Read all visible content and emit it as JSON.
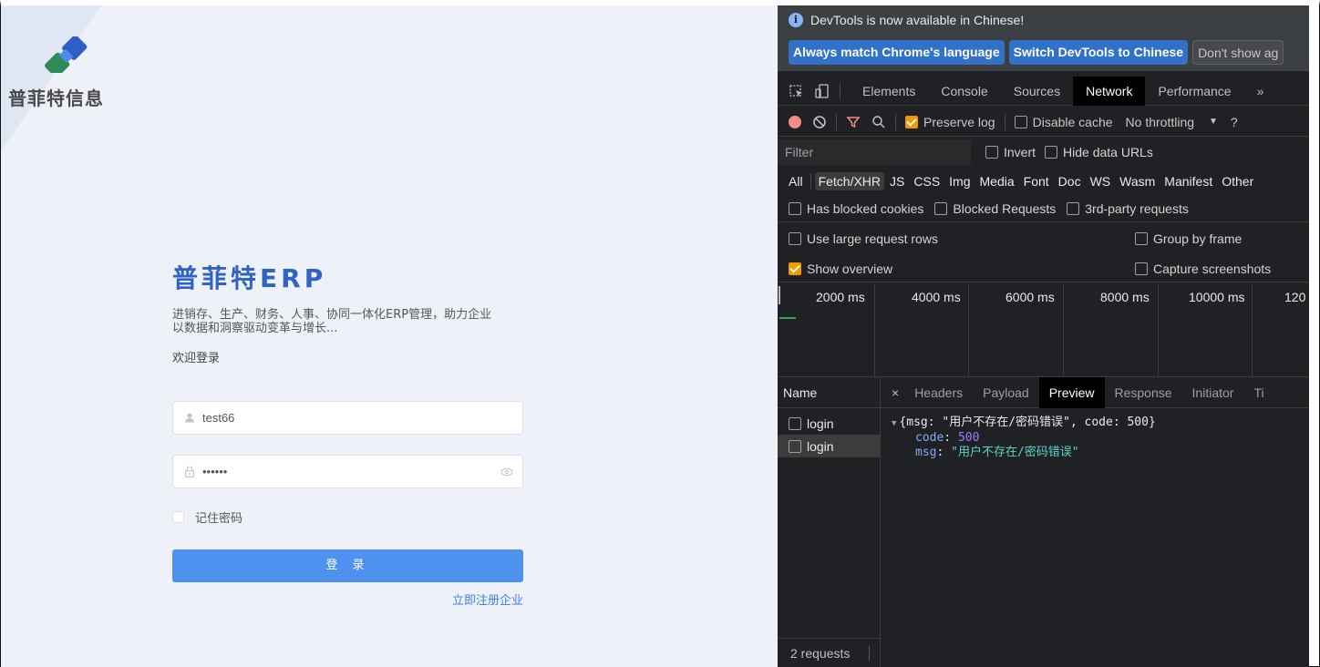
{
  "login": {
    "logo_text": "普菲特信息",
    "brand_title": "普菲特ERP",
    "brand_desc_line1": "进销存、生产、财务、人事、协同一体化ERP管理，助力企业",
    "brand_desc_line2": "以数据和洞察驱动变革与增长...",
    "welcome": "欢迎登录",
    "username_value": "test66",
    "password_value": "••••••",
    "remember_label": "记住密码",
    "login_button": "登 录",
    "register_link": "立即注册企业",
    "colors": {
      "brand": "#2f64c6",
      "button": "#4e91ee",
      "background": "#eef2f8"
    }
  },
  "devtools": {
    "info_message": "DevTools is now available in Chinese!",
    "info_buttons": [
      "Always match Chrome's language",
      "Switch DevTools to Chinese",
      "Don't show ag"
    ],
    "tabs": [
      "Elements",
      "Console",
      "Sources",
      "Network",
      "Performance",
      "»"
    ],
    "active_tab": "Network",
    "toolbar": {
      "preserve_log": "Preserve log",
      "disable_cache": "Disable cache",
      "throttling": "No throttling",
      "throttle_arrow": "▼",
      "more": "?"
    },
    "filter_placeholder": "Filter",
    "invert": "Invert",
    "hide_data_urls": "Hide data URLs",
    "types": [
      "All",
      "Fetch/XHR",
      "JS",
      "CSS",
      "Img",
      "Media",
      "Font",
      "Doc",
      "WS",
      "Wasm",
      "Manifest",
      "Other"
    ],
    "active_type": "Fetch/XHR",
    "has_blocked_cookies": "Has blocked cookies",
    "blocked_requests": "Blocked Requests",
    "third_party": "3rd-party requests",
    "use_large_rows": "Use large request rows",
    "group_by_frame": "Group by frame",
    "show_overview": "Show overview",
    "capture_screenshots": "Capture screenshots",
    "timeline_labels": [
      "2000 ms",
      "4000 ms",
      "6000 ms",
      "8000 ms",
      "10000 ms",
      "120"
    ],
    "name_header": "Name",
    "requests": [
      "login",
      "login"
    ],
    "request_count": "2 requests",
    "detail_close": "×",
    "detail_tabs": [
      "Headers",
      "Payload",
      "Preview",
      "Response",
      "Initiator",
      "Ti"
    ],
    "active_detail_tab": "Preview",
    "preview": {
      "summary": "{msg: \"用户不存在/密码错误\", code: 500}",
      "code_key": "code",
      "code_value": "500",
      "msg_key": "msg",
      "msg_value": "\"用户不存在/密码错误\""
    }
  }
}
